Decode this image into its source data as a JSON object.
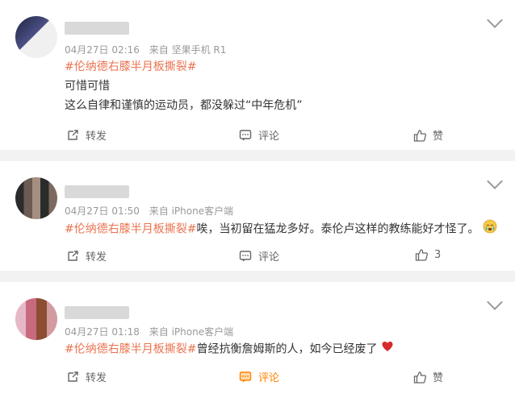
{
  "posts": [
    {
      "time": "04月27日 02:16",
      "source": "来自 坚果手机 R1",
      "hashtag": "#伦纳德右膝半月板撕裂#",
      "lines": [
        "可惜可惜",
        "这么自律和谨慎的运动员，都没躲过“中年危机”"
      ],
      "actions": {
        "share": "转发",
        "comment": "评论",
        "like": "赞"
      }
    },
    {
      "time": "04月27日 01:50",
      "source": "来自 iPhone客户端",
      "hashtag": "#伦纳德右膝半月板撕裂#",
      "text": "唉，当初留在猛龙多好。泰伦卢这样的教练能好才怪了。",
      "actions": {
        "share": "转发",
        "comment": "评论",
        "like": "3"
      }
    },
    {
      "time": "04月27日 01:18",
      "source": "来自 iPhone客户端",
      "hashtag": "#伦纳德右膝半月板撕裂#",
      "text": "曾经抗衡詹姆斯的人，如今已经废了",
      "actions": {
        "share": "转发",
        "comment": "评论",
        "like": "赞"
      }
    }
  ],
  "icons": {
    "more": "chevron-down-icon",
    "share": "share-icon",
    "comment": "comment-icon",
    "like": "thumb-up-icon",
    "emoji2": "crying-face-emoji",
    "emoji3": "red-heart-emoji"
  },
  "colors": {
    "tag": "#eb7350",
    "meta": "#999999",
    "text": "#333333",
    "background": "#f2f2f2",
    "comment_active": "#ff8200",
    "heart": "#d62b2b"
  }
}
